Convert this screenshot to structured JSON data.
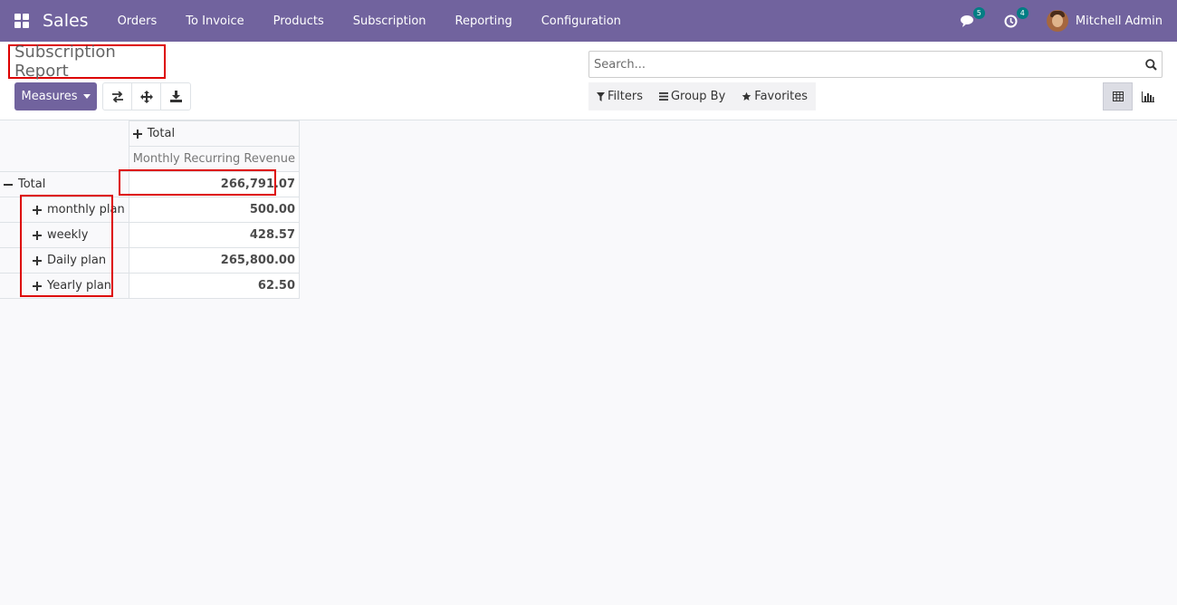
{
  "app": {
    "name": "Sales"
  },
  "menu": [
    "Orders",
    "To Invoice",
    "Products",
    "Subscription",
    "Reporting",
    "Configuration"
  ],
  "systray": {
    "messages_count": "5",
    "activities_count": "4",
    "user_name": "Mitchell Admin"
  },
  "page": {
    "title": "Subscription Report"
  },
  "toolbar": {
    "measures_label": "Measures"
  },
  "search": {
    "placeholder": "Search..."
  },
  "filters": {
    "filters_label": "Filters",
    "groupby_label": "Group By",
    "favorites_label": "Favorites"
  },
  "pivot": {
    "column_header": "Total",
    "measure": "Monthly Recurring Revenue",
    "total_row": {
      "label": "Total",
      "value": "266,791.07"
    },
    "rows": [
      {
        "label": "monthly plan",
        "value": "500.00"
      },
      {
        "label": "weekly",
        "value": "428.57"
      },
      {
        "label": "Daily plan",
        "value": "265,800.00"
      },
      {
        "label": "Yearly plan",
        "value": "62.50"
      }
    ]
  },
  "colors": {
    "brand": "#71639e",
    "badge": "#017e84",
    "highlight": "#dd0000"
  }
}
